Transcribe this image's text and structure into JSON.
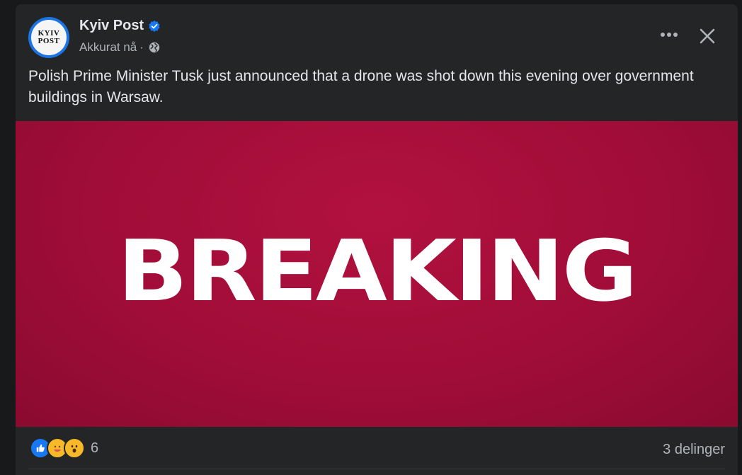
{
  "post": {
    "page_name": "Kyiv Post",
    "avatar_text_line1": "KYIV",
    "avatar_text_line2": "POST",
    "timestamp": "Akkurat nå",
    "separator": "·",
    "text": "Polish Prime Minister Tusk just announced that a drone was shot down this evening over government buildings in Warsaw.",
    "image_text": "BREAKING",
    "reaction_count": "6",
    "shares": "3 delinger"
  },
  "icons": {
    "verified": "verified-badge-icon",
    "privacy": "globe-icon",
    "more": "more-options-icon",
    "close": "close-icon",
    "reactions": [
      "like-icon",
      "care-icon",
      "wow-icon"
    ]
  },
  "colors": {
    "card_bg": "#242526",
    "text_primary": "#e4e6eb",
    "text_secondary": "#b0b3b8",
    "accent": "#1877f2",
    "banner": "#a00d38"
  }
}
